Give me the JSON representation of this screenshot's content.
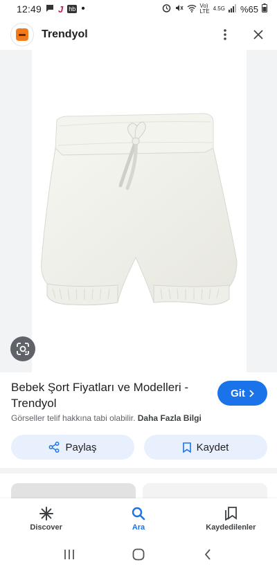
{
  "status_bar": {
    "time": "12:49",
    "hb_badge": "hb",
    "net_top": "Vo)",
    "net_bottom": "LTE",
    "gen": "4.5G",
    "battery": "%65"
  },
  "app_bar": {
    "site_name": "Trendyol"
  },
  "result": {
    "title": "Bebek Şort Fiyatları ve Modelleri - Trendyol",
    "go_label": "Git",
    "copyright": "Görseller telif hakkına tabi olabilir.",
    "more_info": "Daha Fazla Bilgi"
  },
  "actions": {
    "share_label": "Paylaş",
    "save_label": "Kaydet"
  },
  "bottom_nav": {
    "items": [
      {
        "label": "Discover",
        "icon": "discover-icon"
      },
      {
        "label": "Ara",
        "icon": "search-icon",
        "active": true
      },
      {
        "label": "Kaydedilenler",
        "icon": "saved-icon"
      }
    ]
  },
  "colors": {
    "accent": "#1a73e8",
    "tonal_button": "#e8f0fe",
    "brand": "#f27a1a"
  }
}
